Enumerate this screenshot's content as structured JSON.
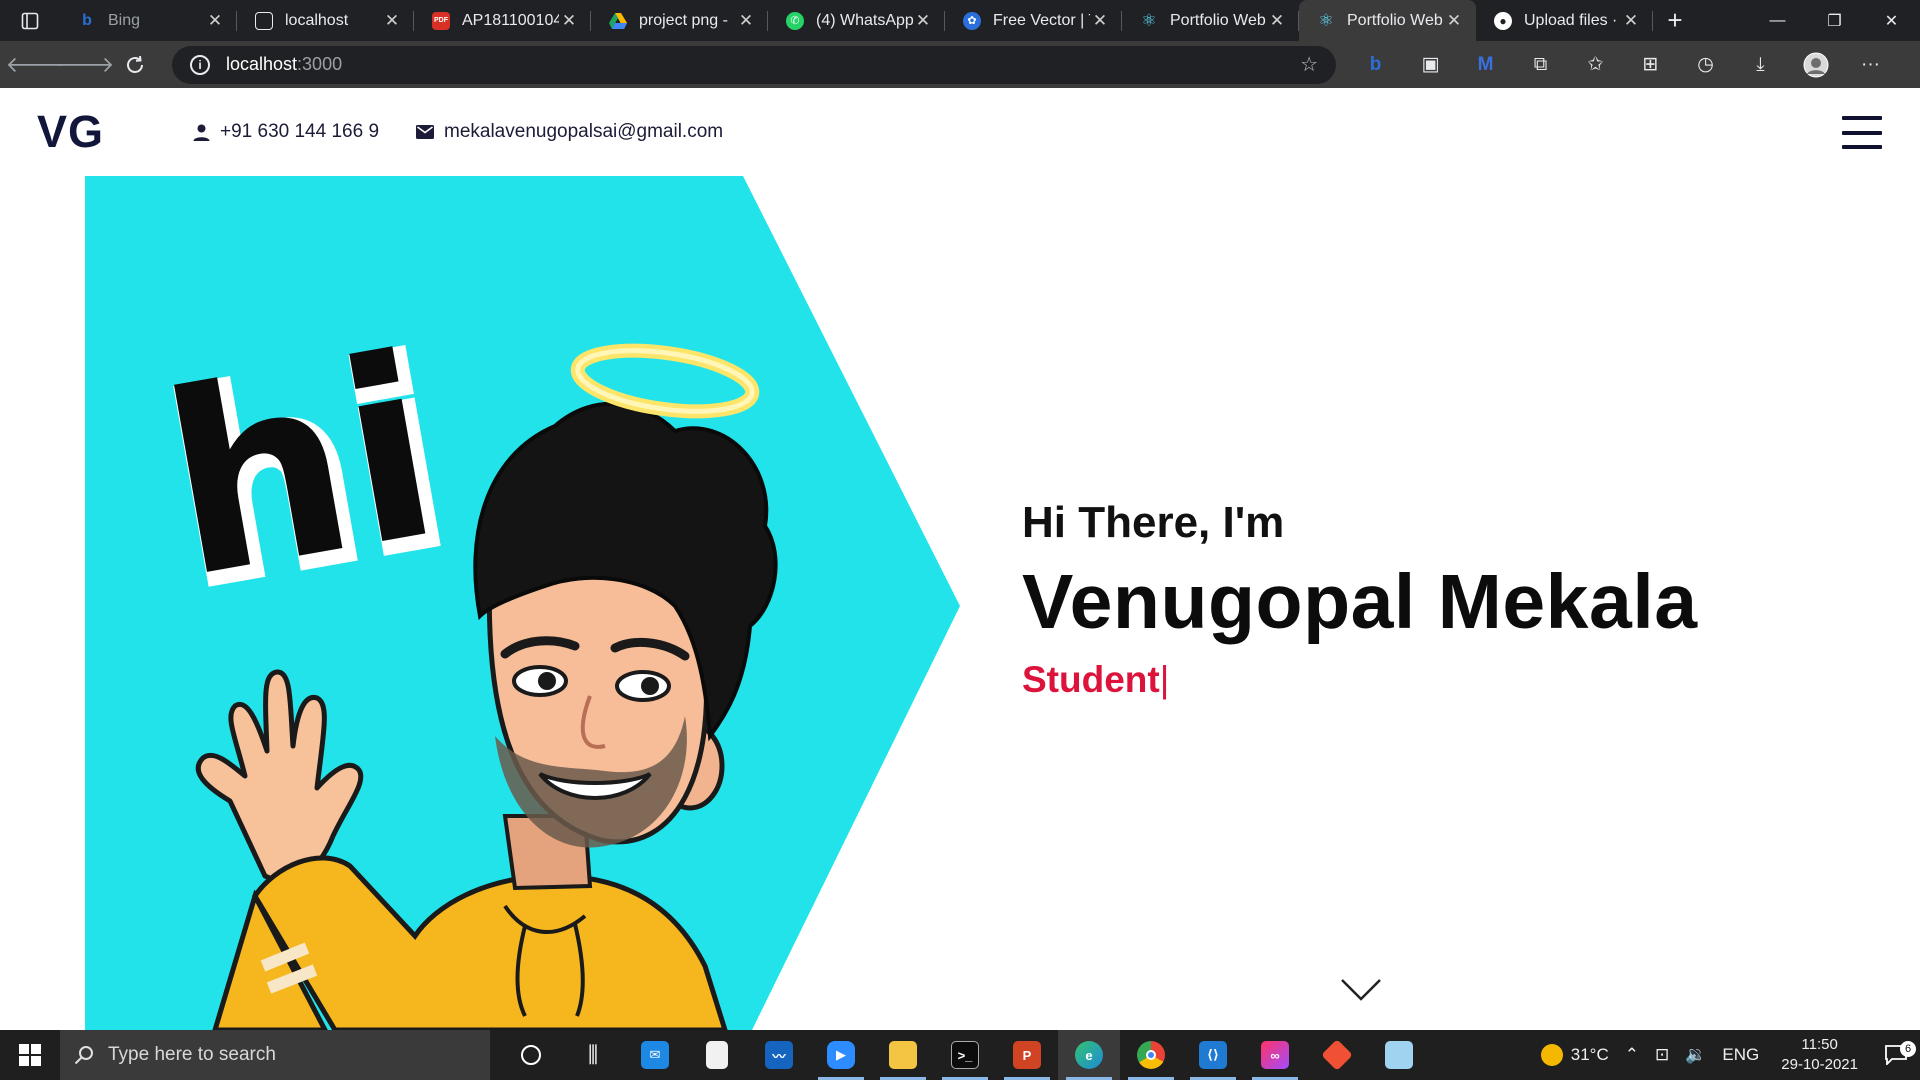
{
  "browser": {
    "tabs": [
      {
        "title": "Bing",
        "favicon_color": "#2b6fd6",
        "favicon_glyph": "b"
      },
      {
        "title": "localhost",
        "favicon_color": "#5f6368",
        "favicon_glyph": "◌"
      },
      {
        "title": "AP181100104",
        "favicon_color": "#d93025",
        "favicon_glyph": "PDF"
      },
      {
        "title": "project png -",
        "favicon_color": "#1fa463",
        "favicon_glyph": "▲"
      },
      {
        "title": "(4) WhatsApp",
        "favicon_color": "#25d366",
        "favicon_glyph": "✆"
      },
      {
        "title": "Free Vector | T",
        "favicon_color": "#2a6fdb",
        "favicon_glyph": "✿"
      },
      {
        "title": "Portfolio Web",
        "favicon_color": "#1b9ec7",
        "favicon_glyph": "⚛"
      },
      {
        "title": "Portfolio Web",
        "favicon_color": "#1b9ec7",
        "favicon_glyph": "⚛"
      },
      {
        "title": "Upload files · ",
        "favicon_color": "#ffffff",
        "favicon_glyph": "●"
      }
    ],
    "active_tab_index": 7,
    "address": {
      "host": "localhost",
      "rest": ":3000"
    }
  },
  "site": {
    "logo": "VG",
    "phone": "+91 630 144 166 9",
    "email": "mekalavenugopalsai@gmail.com",
    "hero": {
      "greeting": "Hi There, I'm",
      "name": "Venugopal Mekala",
      "role": "Student",
      "cursor": "|",
      "art_text": "hi"
    },
    "colors": {
      "accent_cyan": "#22e3ea",
      "role_red": "#dc143c",
      "navy": "#12163a"
    }
  },
  "taskbar": {
    "search_placeholder": "Type here to search",
    "weather": "31°C",
    "language": "ENG",
    "time": "11:50",
    "date": "29-10-2021",
    "notification_count": "6",
    "apps": [
      "cortana-icon",
      "task-view-icon",
      "mail-icon",
      "file-icon",
      "stocks-icon",
      "zoom-icon",
      "file-explorer-icon",
      "terminal-icon",
      "powerpoint-icon",
      "edge-icon",
      "chrome-icon",
      "vscode-icon",
      "creative-cloud-icon",
      "git-icon",
      "notepad-icon"
    ]
  }
}
